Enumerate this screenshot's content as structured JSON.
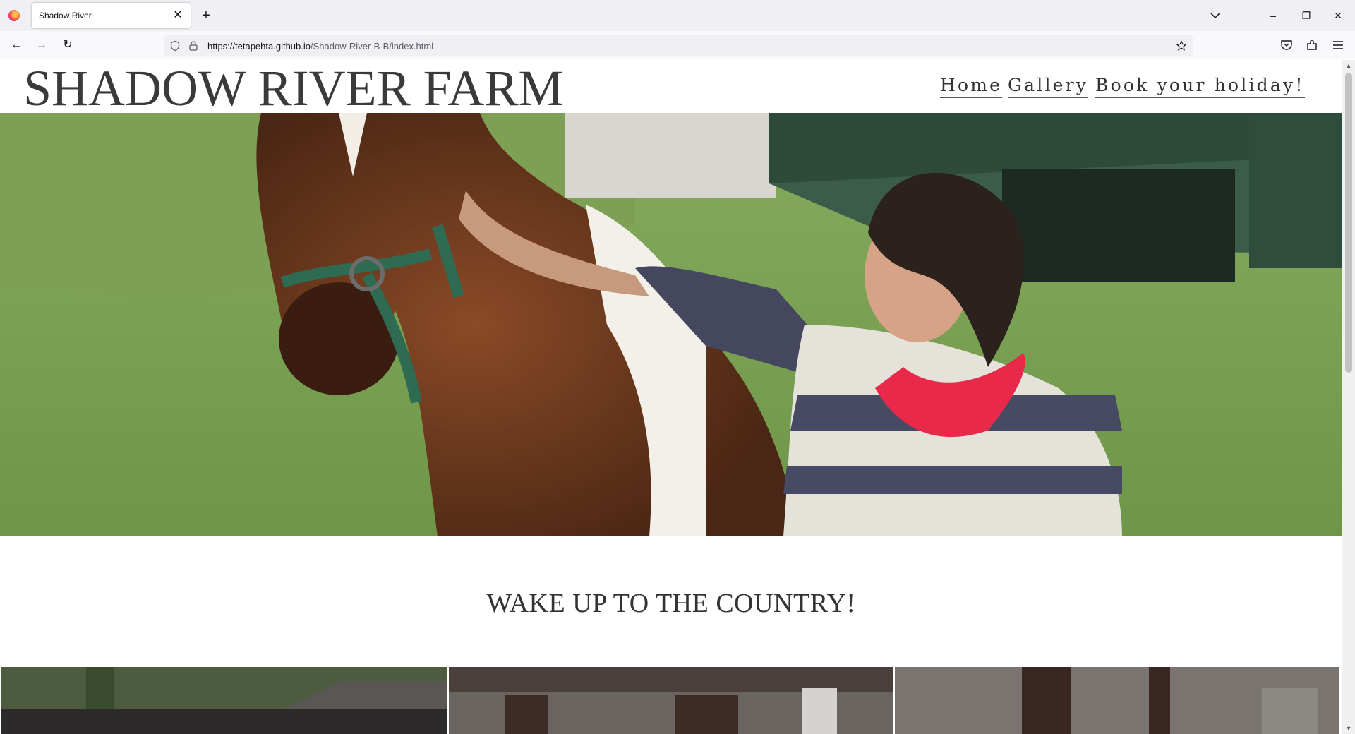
{
  "browser": {
    "tab_title": "Shadow River",
    "tab_close": "✕",
    "new_tab": "+",
    "url_host": "https://tetapehta.github.io",
    "url_path": "/Shadow-River-B-B/index.html",
    "window_controls": {
      "minimize": "–",
      "restore": "❐",
      "close": "✕"
    },
    "nav": {
      "back": "←",
      "forward": "→",
      "reload": "↻"
    }
  },
  "site": {
    "brand": "SHADOW RIVER FARM",
    "nav": [
      "Home",
      "Gallery",
      "Book your holiday!"
    ],
    "hero_alt": "Woman petting a brown and white pony in a green field",
    "section_title": "WAKE UP TO THE COUNTRY!"
  },
  "colors": {
    "text": "#333333",
    "grass": "#7ea35a",
    "barn_green": "#2d4a3a"
  }
}
